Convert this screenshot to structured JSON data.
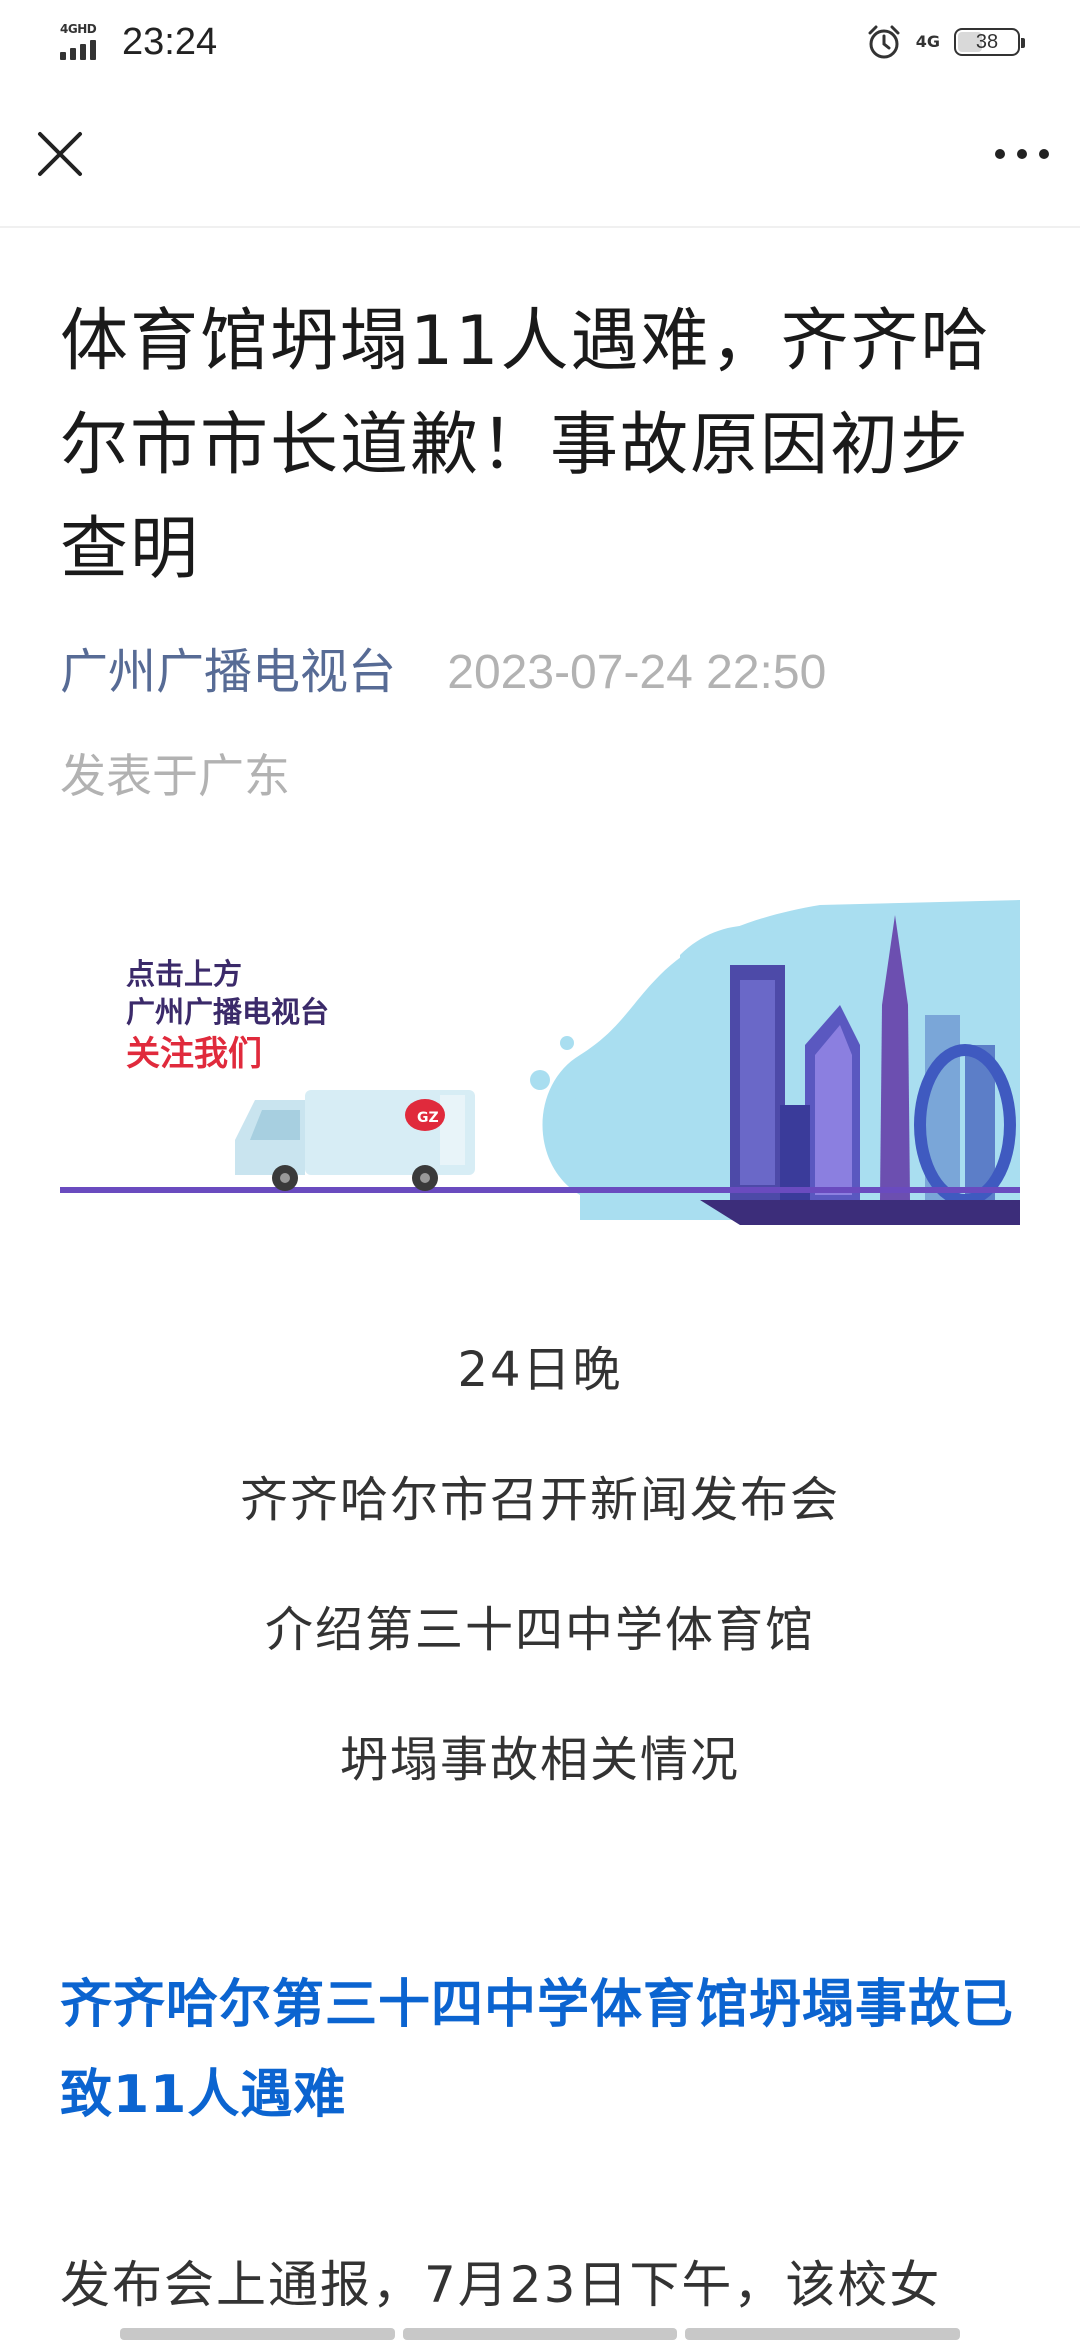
{
  "status_bar": {
    "network_label": "4GHD",
    "time": "23:24",
    "right_network_label": "4G",
    "battery": "38"
  },
  "article": {
    "title": "体育馆坍塌11人遇难，齐齐哈尔市市长道歉！事故原因初步查明",
    "source": "广州广播电视台",
    "date": "2023-07-24 22:50",
    "location": "发表于广东"
  },
  "banner": {
    "line1": "点击上方",
    "line2": "广州广播电视台",
    "line3": "关注我们",
    "truck_logo": "GZ"
  },
  "intro_lines": [
    "24日晚",
    "齐齐哈尔市召开新闻发布会",
    "介绍第三十四中学体育馆",
    "坍塌事故相关情况"
  ],
  "subheading": "齐齐哈尔第三十四中学体育馆坍塌事故已致11人遇难",
  "body_start": "发布会上通报，7月23日下午，该校女",
  "icons": {
    "close": "close-icon",
    "more": "more-icon",
    "alarm": "alarm-icon",
    "signal": "signal-icon",
    "battery": "battery-icon"
  },
  "colors": {
    "source_link": "#576b95",
    "subheading": "#0b64d0",
    "banner_cta": "#e02a3c"
  }
}
